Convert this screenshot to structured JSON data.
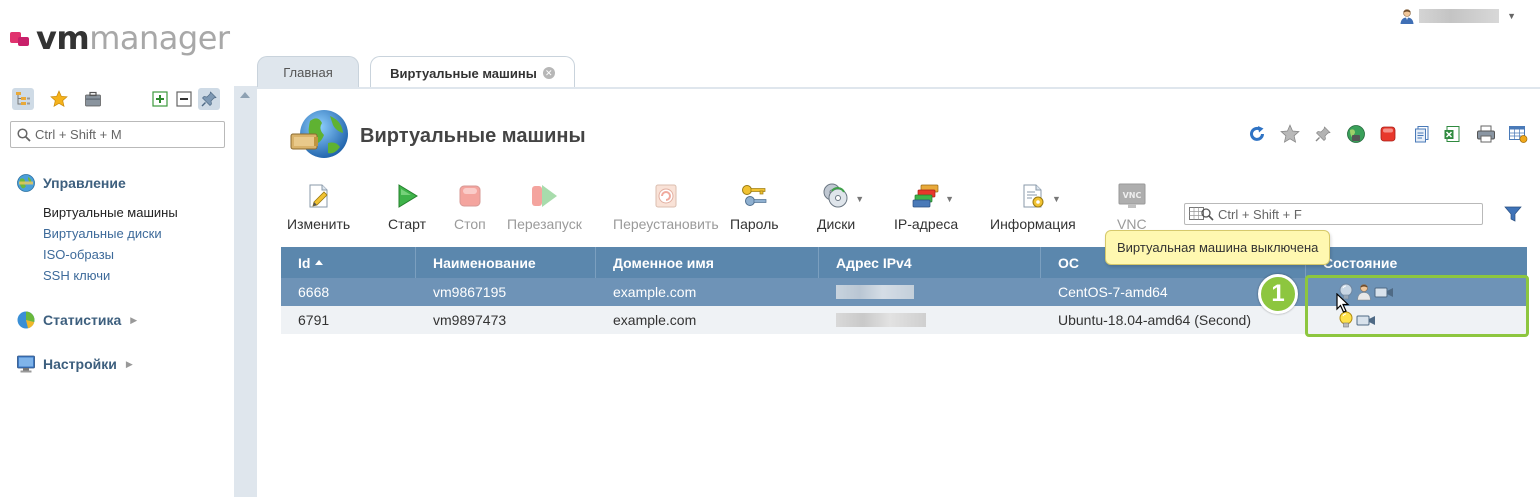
{
  "logo": {
    "vm": "vm",
    "manager": "manager"
  },
  "user": {
    "menu_icon": "user-icon"
  },
  "colors": {
    "accent": "#5b87ad",
    "selected_row": "#6e93b7",
    "highlight": "#8dc63f",
    "tooltip_bg": "#fff8b0",
    "logo_pink": "#e0336e"
  },
  "sidebar": {
    "search_placeholder": "Ctrl + Shift + M",
    "tools": [
      "tree-icon",
      "star-icon",
      "briefcase-icon",
      "expand-icon",
      "collapse-icon",
      "pin-icon"
    ],
    "groups": [
      {
        "label": "Управление",
        "icon": "globe-icon",
        "items": [
          "Виртуальные машины",
          "Виртуальные диски",
          "ISO-образы",
          "SSH ключи"
        ]
      },
      {
        "label": "Статистика",
        "icon": "pie-chart-icon"
      },
      {
        "label": "Настройки",
        "icon": "monitor-icon"
      }
    ]
  },
  "tabs": [
    {
      "label": "Главная"
    },
    {
      "label": "Виртуальные машины"
    }
  ],
  "page": {
    "title": "Виртуальные машины"
  },
  "header_tools": [
    "refresh-icon",
    "star-icon",
    "pin-icon",
    "globe-icon",
    "stop-icon",
    "copy-icon",
    "excel-icon",
    "print-icon",
    "table-settings-icon"
  ],
  "toolbar": {
    "edit": "Изменить",
    "start": "Старт",
    "stop": "Стоп",
    "restart": "Перезапуск",
    "reinstall": "Переустановить",
    "password": "Пароль",
    "disks": "Диски",
    "ip": "IP-адреса",
    "info": "Информация",
    "vnc": "VNC",
    "vnc_icon_text": "VNC"
  },
  "grid_search": {
    "placeholder": "Ctrl + Shift + F"
  },
  "table": {
    "columns": [
      "Id",
      "Наименование",
      "Доменное имя",
      "Адрес IPv4",
      "ОС",
      "Состояние"
    ],
    "rows": [
      {
        "id": "6668",
        "name": "vm9867195",
        "domain": "example.com",
        "os": "CentOS-7-amd64"
      },
      {
        "id": "6791",
        "name": "vm9897473",
        "domain": "example.com",
        "os": "Ubuntu-18.04-amd64 (Second)"
      }
    ]
  },
  "tooltip": "Виртуальная машина выключена",
  "annotation": {
    "number": "1"
  }
}
